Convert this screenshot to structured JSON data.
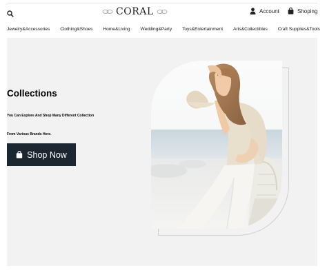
{
  "header": {
    "logo_text": "CORAL",
    "account_label": "Account",
    "cart_label": "Shoping"
  },
  "nav": {
    "items": [
      {
        "label": "Jewelry&Accessories"
      },
      {
        "label": "Clothing&Shoes"
      },
      {
        "label": "Home&Living"
      },
      {
        "label": "Wedding&Party"
      },
      {
        "label": "Toys&Entertainment"
      },
      {
        "label": "Arts&Collectibles"
      },
      {
        "label": "Craft Supplies&Tools"
      }
    ]
  },
  "hero": {
    "title": "Collections",
    "subtitle_line1": "You Can Explore And Shop Many Different Collection",
    "subtitle_line2": "From Various Brands Here.",
    "cta_label": "Shop Now"
  },
  "colors": {
    "hero_bg": "#f2f2f2",
    "button_bg": "#1b2630",
    "button_text": "#ffffff"
  },
  "icons": [
    "search-icon",
    "user-icon",
    "shopping-bag-icon",
    "ornament-icon"
  ]
}
